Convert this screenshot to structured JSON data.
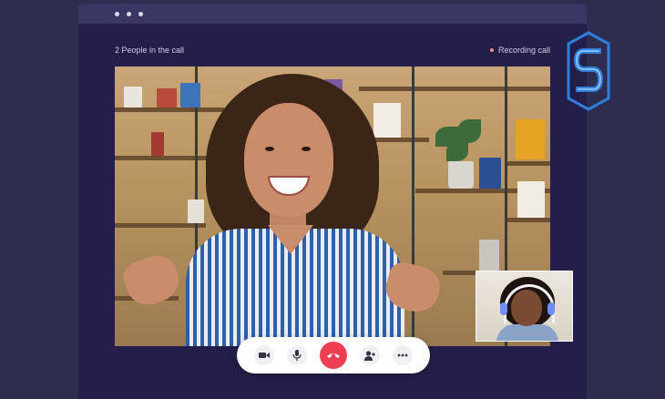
{
  "call": {
    "participants_text": "2 People in the call",
    "recording_text": "Recording call"
  },
  "controls": [
    {
      "name": "video-button",
      "icon": "video-camera-icon"
    },
    {
      "name": "mic-button",
      "icon": "microphone-icon"
    },
    {
      "name": "end-call-button",
      "icon": "phone-hangup-icon"
    },
    {
      "name": "add-participant-button",
      "icon": "add-user-icon"
    },
    {
      "name": "more-options-button",
      "icon": "more-horizontal-icon"
    }
  ],
  "colors": {
    "background": "#2f2d4f",
    "window": "#241f4a",
    "titlebar": "#3b3764",
    "end_call": "#ee3e52",
    "logo": "#2f7fd9"
  }
}
